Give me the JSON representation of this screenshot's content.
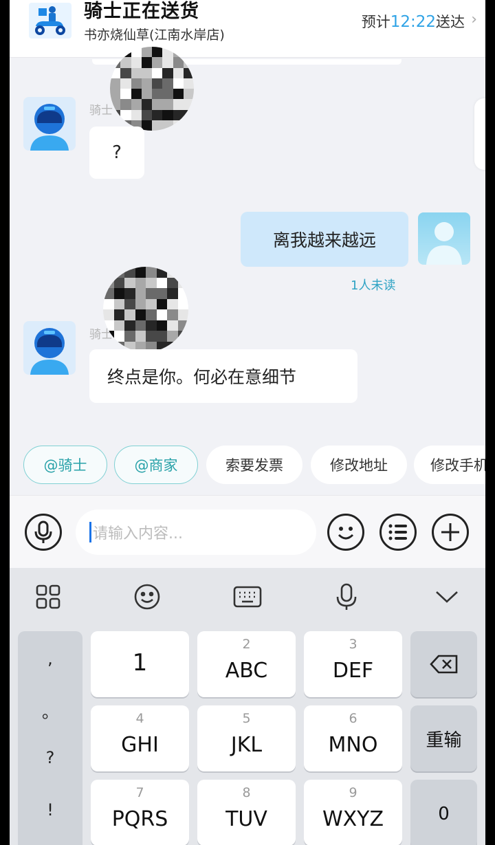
{
  "header": {
    "title": "骑士正在送货",
    "store": "书亦烧仙草(江南水岸店)",
    "eta_prefix": "预计",
    "eta_time": "12:22",
    "eta_suffix": "送达",
    "chevron": "›"
  },
  "side_handle": {
    "glyph": "《"
  },
  "messages": [
    {
      "sender": "rider",
      "sender_name": "骑士",
      "text": "?"
    },
    {
      "sender": "me",
      "text": "离我越来越远",
      "read_status": "1人未读"
    },
    {
      "sender": "rider",
      "sender_name": "骑士",
      "text": "终点是你。何必在意细节"
    }
  ],
  "quick_actions": [
    "@骑士",
    "@商家",
    "索要发票",
    "修改地址",
    "修改手机"
  ],
  "input": {
    "placeholder": "请输入内容...",
    "icons": [
      "voice-icon",
      "emoji-icon",
      "list-icon",
      "plus-icon"
    ]
  },
  "keyboard": {
    "toolbar_icons": [
      "apps-grid-icon",
      "emoji-icon",
      "keyboard-icon",
      "mic-icon",
      "collapse-chevron-icon"
    ],
    "punctuation": [
      ",",
      "。",
      "?",
      "!"
    ],
    "keys": [
      {
        "num": "",
        "letters": "1"
      },
      {
        "num": "2",
        "letters": "ABC"
      },
      {
        "num": "3",
        "letters": "DEF"
      },
      {
        "num": "4",
        "letters": "GHI"
      },
      {
        "num": "5",
        "letters": "JKL"
      },
      {
        "num": "6",
        "letters": "MNO"
      },
      {
        "num": "7",
        "letters": "PQRS"
      },
      {
        "num": "8",
        "letters": "TUV"
      },
      {
        "num": "9",
        "letters": "WXYZ"
      }
    ],
    "reenter_label": "重输",
    "zero_label": "0"
  },
  "colors": {
    "accent_blue": "#2fa3e6",
    "teal": "#27a1a8",
    "my_bubble": "#cfe8fb"
  }
}
